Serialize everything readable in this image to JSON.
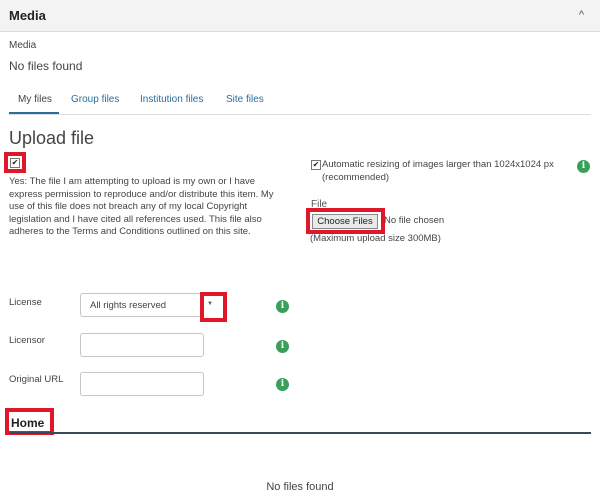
{
  "panel": {
    "title": "Media",
    "chevron": "^"
  },
  "media": {
    "label": "Media",
    "empty_text": "No files found"
  },
  "tabs": [
    {
      "label": "My files",
      "active": true
    },
    {
      "label": "Group files",
      "active": false
    },
    {
      "label": "Institution files",
      "active": false
    },
    {
      "label": "Site files",
      "active": false
    }
  ],
  "upload": {
    "heading": "Upload file",
    "consent_checked": true,
    "consent_text": "Yes: The file I am attempting to upload is my own or I have express permission to reproduce and/or distribute this item. My use of this file does not breach any of my local Copyright legislation and I have cited all references used. This file also adheres to the Terms and Conditions outlined on this site.",
    "resize_checked": true,
    "resize_text": "Automatic resizing of images larger than 1024x1024 px (recommended)",
    "file_label": "File",
    "choose_button": "Choose Files",
    "no_file_text": "No file chosen",
    "max_size_text": "(Maximum upload size 300MB)"
  },
  "fields": {
    "license_label": "License",
    "license_value": "All rights reserved",
    "licensor_label": "Licensor",
    "licensor_value": "",
    "original_url_label": "Original URL",
    "original_url_value": ""
  },
  "home": {
    "title": "Home",
    "empty_text": "No files found"
  },
  "icons": {
    "info": "info-icon",
    "chevron": "chevron-up-icon",
    "select_arrow": "caret-down-icon"
  },
  "colors": {
    "link": "#2a6f9b",
    "info": "#39a05a",
    "highlight": "#e0172b",
    "header_bg": "#f3f3f3"
  }
}
